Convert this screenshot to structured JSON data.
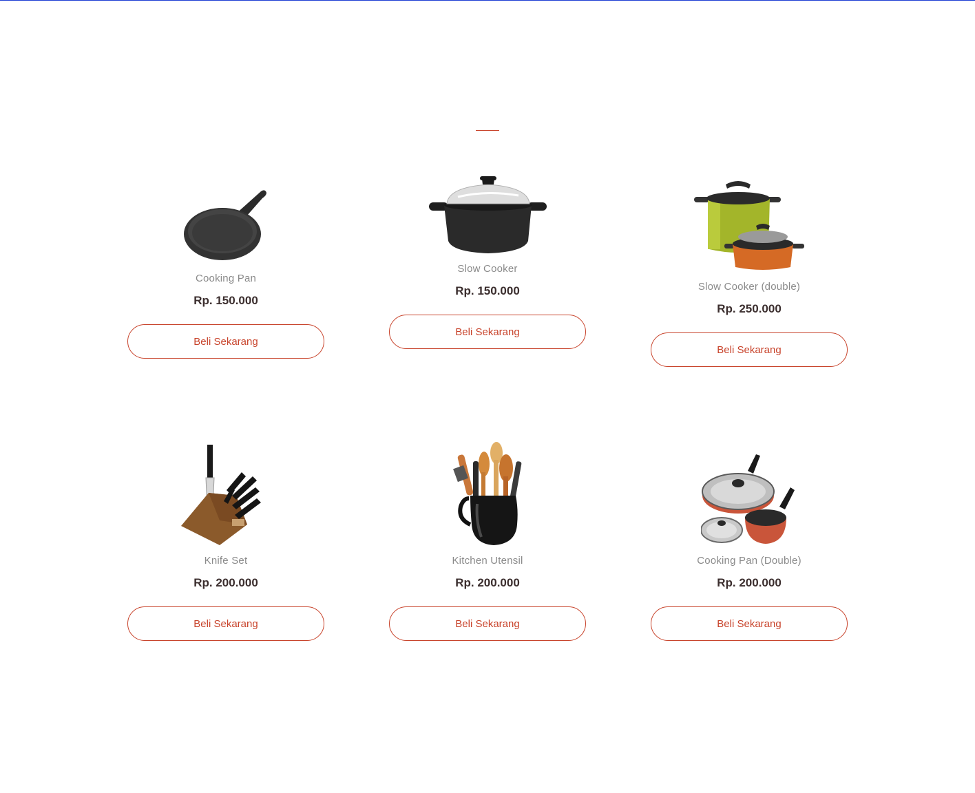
{
  "accent_color": "#c8432b",
  "products": [
    {
      "name": "Cooking Pan",
      "price": "Rp. 150.000",
      "button_label": "Beli Sekarang",
      "image_icon": "frying-pan-icon"
    },
    {
      "name": "Slow Cooker",
      "price": "Rp. 150.000",
      "button_label": "Beli Sekarang",
      "image_icon": "cooking-pot-icon"
    },
    {
      "name": "Slow Cooker (double)",
      "price": "Rp. 250.000",
      "button_label": "Beli Sekarang",
      "image_icon": "double-pot-icon"
    },
    {
      "name": "Knife Set",
      "price": "Rp. 200.000",
      "button_label": "Beli Sekarang",
      "image_icon": "knife-block-icon"
    },
    {
      "name": "Kitchen Utensil",
      "price": "Rp. 200.000",
      "button_label": "Beli Sekarang",
      "image_icon": "utensil-jar-icon"
    },
    {
      "name": "Cooking Pan (Double)",
      "price": "Rp. 200.000",
      "button_label": "Beli Sekarang",
      "image_icon": "pan-set-icon"
    }
  ]
}
